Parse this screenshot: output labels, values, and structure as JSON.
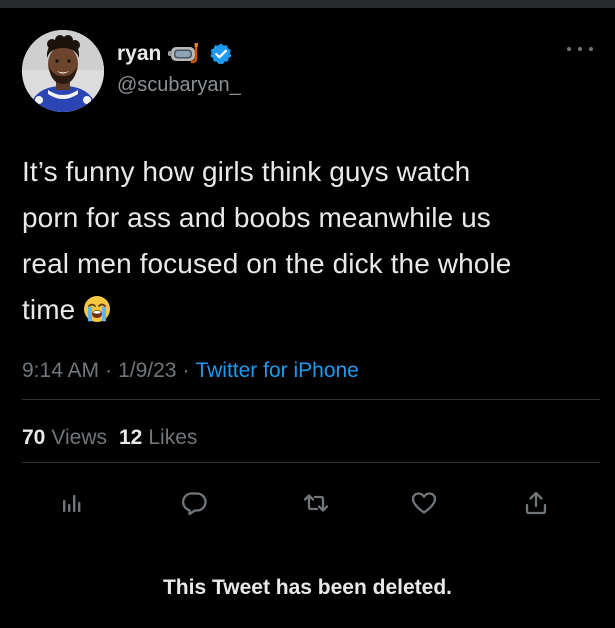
{
  "tweet": {
    "author": {
      "display_name": "ryan",
      "handle": "@scubaryan_",
      "name_emoji_icon": "diving-mask-icon",
      "verified_icon": "verified-badge-icon"
    },
    "text_lines": [
      "It’s funny how girls think guys watch",
      "porn for ass and boobs meanwhile us",
      "real men focused on the dick the whole",
      "time"
    ],
    "text_emoji_icon": "loudly-crying-face-icon",
    "time": "9:14 AM",
    "date": "1/9/23",
    "source": "Twitter for iPhone",
    "separator": "·",
    "views_count": "70",
    "views_label": "Views",
    "likes_count": "12",
    "likes_label": "Likes"
  },
  "actions": [
    {
      "icon": "analytics-icon"
    },
    {
      "icon": "reply-icon"
    },
    {
      "icon": "retweet-icon"
    },
    {
      "icon": "like-icon"
    },
    {
      "icon": "share-icon"
    }
  ],
  "notice": "This Tweet has been deleted.",
  "colors": {
    "background": "#000000",
    "text": "#e7e9ea",
    "muted": "#71767b",
    "link": "#1d9bf0",
    "verified": "#1d9bf0",
    "divider": "#2f3336"
  }
}
